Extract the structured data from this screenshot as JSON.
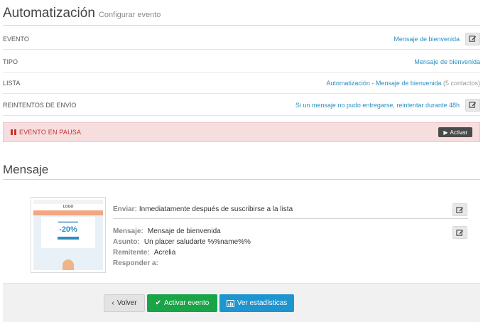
{
  "header": {
    "title": "Automatización",
    "subtitle": "Configurar evento"
  },
  "rows": {
    "evento": {
      "label": "EVENTO",
      "value": "Mensaje de bienvenida"
    },
    "tipo": {
      "label": "TIPO",
      "value": "Mensaje de bienvenida"
    },
    "lista": {
      "label": "LISTA",
      "value": "Automatización - Mensaje de bienvenida",
      "count": "(5 contactos)"
    },
    "reintentos": {
      "label": "REINTENTOS DE ENVÍO",
      "value": "Si un mensaje no pudo entregarse, reintentar durante 48h"
    }
  },
  "pause_banner": {
    "text": "EVENTO EN PAUSA",
    "button": "Activar"
  },
  "message_section": {
    "title": "Mensaje",
    "thumbnail": {
      "logo": "LOGO",
      "discount": "-20%"
    },
    "send": {
      "label": "Enviar:",
      "value": "Inmediatamente después de suscribirse a la lista"
    },
    "details": [
      {
        "label": "Mensaje:",
        "value": "Mensaje de bienvenida"
      },
      {
        "label": "Asunto:",
        "value": "Un placer saludarte %%name%%"
      },
      {
        "label": "Remitente:",
        "value": "Acrelia"
      },
      {
        "label": "Responder a:",
        "value": ""
      }
    ]
  },
  "footer": {
    "back": "Volver",
    "activate": "Activar evento",
    "stats": "Ver estadísticas"
  },
  "colors": {
    "link": "#2a8fc0",
    "pause_bg": "#f6dedf",
    "pause_text": "#c9302c",
    "green": "#19a447",
    "blue": "#1e95cf"
  }
}
